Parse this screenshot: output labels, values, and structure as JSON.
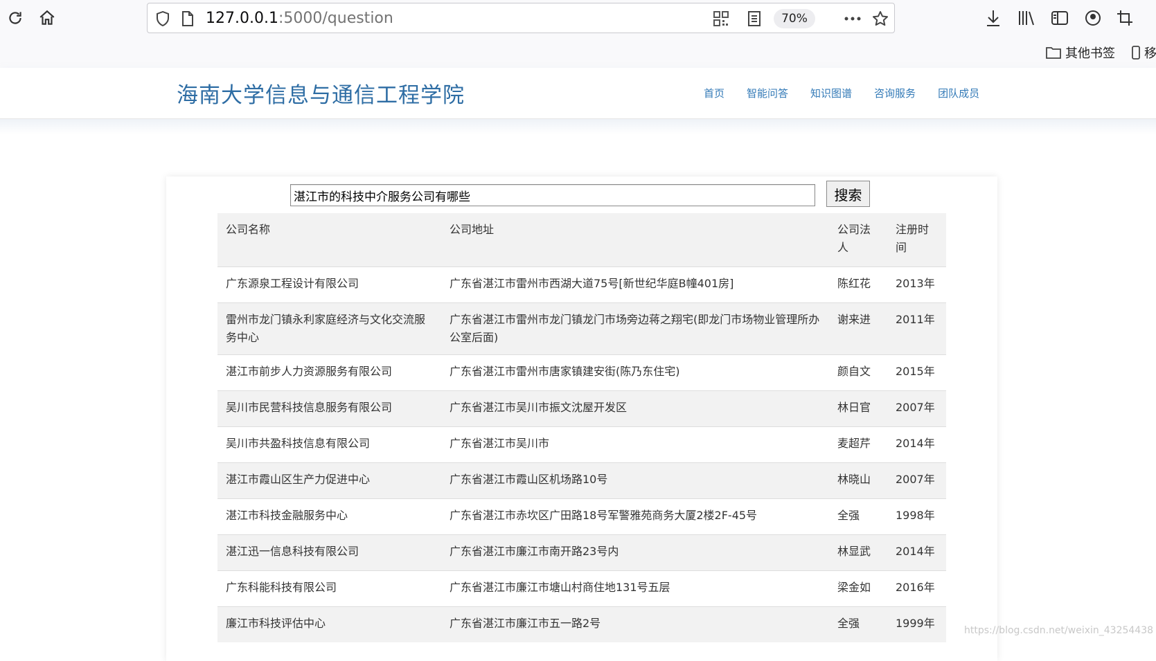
{
  "browser": {
    "url_host": "127.0.0.1",
    "url_path": ":5000/question",
    "zoom": "70%",
    "bookmarks": {
      "other": "其他书签",
      "mobile": "移"
    }
  },
  "site": {
    "title": "海南大学信息与通信工程学院",
    "nav": [
      "首页",
      "智能问答",
      "知识图谱",
      "咨询服务",
      "团队成员"
    ]
  },
  "search": {
    "query": "湛江市的科技中介服务公司有哪些",
    "button_label": "搜索"
  },
  "table": {
    "headers": [
      "公司名称",
      "公司地址",
      "公司法人",
      "注册时间"
    ],
    "rows": [
      [
        "广东源泉工程设计有限公司",
        "广东省湛江市雷州市西湖大道75号[新世纪华庭B幢401房]",
        "陈红花",
        "2013年"
      ],
      [
        "雷州市龙门镇永利家庭经济与文化交流服务中心",
        "广东省湛江市雷州市龙门镇龙门市场旁边蒋之翔宅(即龙门市场物业管理所办公室后面)",
        "谢来进",
        "2011年"
      ],
      [
        "湛江市前步人力资源服务有限公司",
        "广东省湛江市雷州市唐家镇建安街(陈乃东住宅)",
        "颜自文",
        "2015年"
      ],
      [
        "吴川市民营科技信息服务有限公司",
        "广东省湛江市吴川市振文沈屋开发区",
        "林日官",
        "2007年"
      ],
      [
        "吴川市共盈科技信息有限公司",
        "广东省湛江市吴川市",
        "麦超芹",
        "2014年"
      ],
      [
        "湛江市霞山区生产力促进中心",
        "广东省湛江市霞山区机场路10号",
        "林晓山",
        "2007年"
      ],
      [
        "湛江市科技金融服务中心",
        "广东省湛江市赤坎区广田路18号军警雅苑商务大厦2楼2F-45号",
        "全强",
        "1998年"
      ],
      [
        "湛江迅一信息科技有限公司",
        "广东省湛江市廉江市南开路23号内",
        "林显武",
        "2014年"
      ],
      [
        "广东科能科技有限公司",
        "广东省湛江市廉江市塘山村商住地131号五层",
        "梁金如",
        "2016年"
      ],
      [
        "廉江市科技评估中心",
        "广东省湛江市廉江市五一路2号",
        "全强",
        "1999年"
      ]
    ]
  },
  "watermark": "https://blog.csdn.net/weixin_43254438"
}
